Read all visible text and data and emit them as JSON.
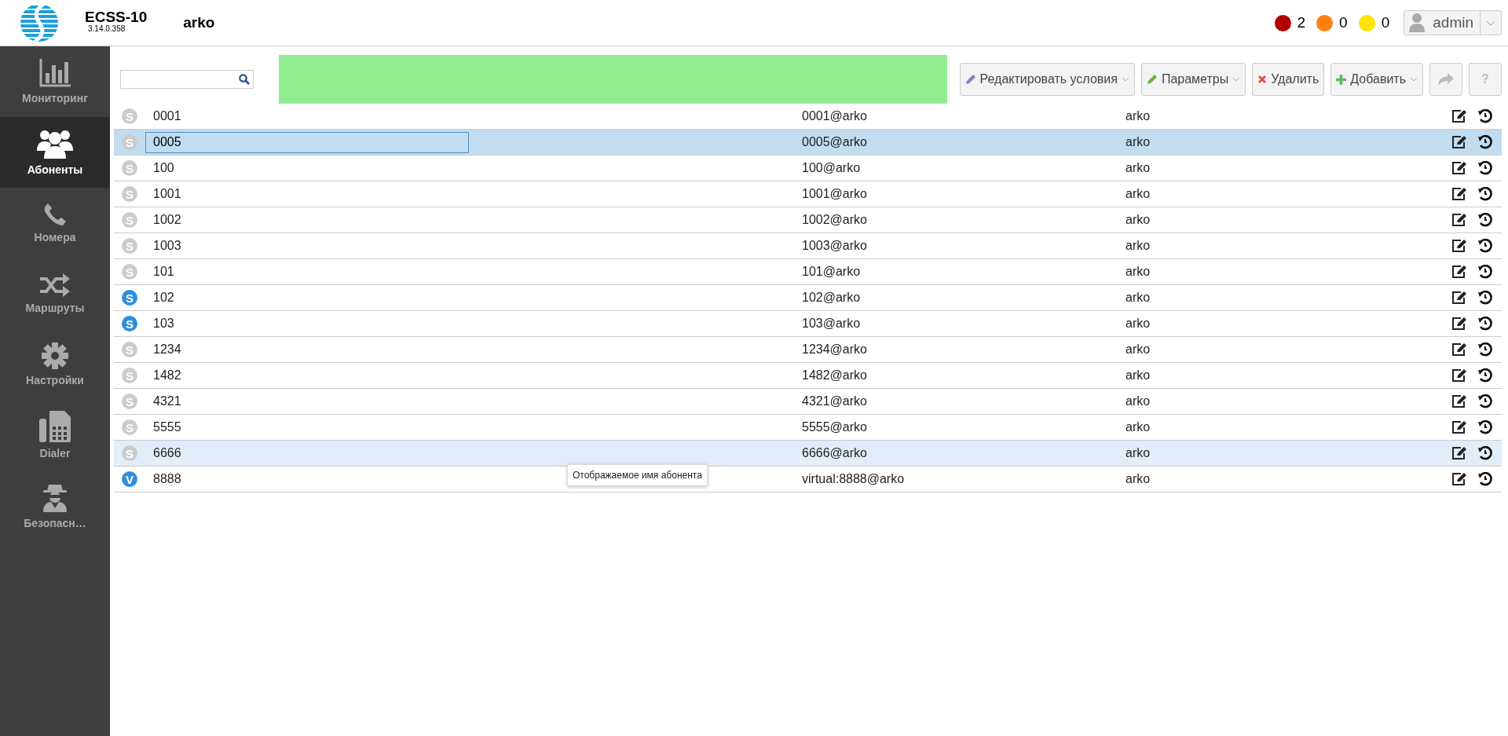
{
  "header": {
    "product": "ECSS-10",
    "version": "3.14.0.358",
    "domain": "arko",
    "alarms": [
      {
        "count": "2",
        "color": "#b30000"
      },
      {
        "count": "0",
        "color": "#ff7f0e"
      },
      {
        "count": "0",
        "color": "#ffe600"
      }
    ],
    "user": "admin"
  },
  "sidebar": {
    "items": [
      {
        "label": "Мониторинг",
        "kind": "chart",
        "selected": false
      },
      {
        "label": "Абоненты",
        "kind": "users",
        "selected": true
      },
      {
        "label": "Номера",
        "kind": "phone",
        "selected": false
      },
      {
        "label": "Маршруты",
        "kind": "shuffle",
        "selected": false
      },
      {
        "label": "Настройки",
        "kind": "gear",
        "selected": false
      },
      {
        "label": "Dialer",
        "kind": "fax",
        "selected": false
      },
      {
        "label": "Безопасн…",
        "kind": "spy",
        "selected": false
      }
    ]
  },
  "toolbar": {
    "buttons": [
      {
        "label": "Редактировать условия",
        "kind": "edit",
        "dropdown": true,
        "disabled": false
      },
      {
        "label": "Параметры",
        "kind": "params",
        "dropdown": true,
        "disabled": false
      },
      {
        "label": "Удалить",
        "kind": "delete",
        "dropdown": false,
        "disabled": false
      },
      {
        "label": "Добавить",
        "kind": "add",
        "dropdown": true,
        "disabled": false
      },
      {
        "kind": "share",
        "disabled": true
      },
      {
        "label": "?",
        "kind": "help",
        "disabled": true
      }
    ]
  },
  "table": {
    "rows": [
      {
        "badge": "S",
        "active": false,
        "number": "0001",
        "uri": "0001@arko",
        "domain": "arko",
        "selected": false,
        "editing": false,
        "hovered": false
      },
      {
        "badge": "S",
        "active": false,
        "number": "0005",
        "uri": "0005@arko",
        "domain": "arko",
        "selected": true,
        "editing": true,
        "hovered": false
      },
      {
        "badge": "S",
        "active": false,
        "number": "100",
        "uri": "100@arko",
        "domain": "arko",
        "selected": false,
        "editing": false,
        "hovered": false
      },
      {
        "badge": "S",
        "active": false,
        "number": "1001",
        "uri": "1001@arko",
        "domain": "arko",
        "selected": false,
        "editing": false,
        "hovered": false
      },
      {
        "badge": "S",
        "active": false,
        "number": "1002",
        "uri": "1002@arko",
        "domain": "arko",
        "selected": false,
        "editing": false,
        "hovered": false
      },
      {
        "badge": "S",
        "active": false,
        "number": "1003",
        "uri": "1003@arko",
        "domain": "arko",
        "selected": false,
        "editing": false,
        "hovered": false
      },
      {
        "badge": "S",
        "active": false,
        "number": "101",
        "uri": "101@arko",
        "domain": "arko",
        "selected": false,
        "editing": false,
        "hovered": false
      },
      {
        "badge": "S",
        "active": true,
        "number": "102",
        "uri": "102@arko",
        "domain": "arko",
        "selected": false,
        "editing": false,
        "hovered": false
      },
      {
        "badge": "S",
        "active": true,
        "number": "103",
        "uri": "103@arko",
        "domain": "arko",
        "selected": false,
        "editing": false,
        "hovered": false
      },
      {
        "badge": "S",
        "active": false,
        "number": "1234",
        "uri": "1234@arko",
        "domain": "arko",
        "selected": false,
        "editing": false,
        "hovered": false
      },
      {
        "badge": "S",
        "active": false,
        "number": "1482",
        "uri": "1482@arko",
        "domain": "arko",
        "selected": false,
        "editing": false,
        "hovered": false
      },
      {
        "badge": "S",
        "active": false,
        "number": "4321",
        "uri": "4321@arko",
        "domain": "arko",
        "selected": false,
        "editing": false,
        "hovered": false
      },
      {
        "badge": "S",
        "active": false,
        "number": "5555",
        "uri": "5555@arko",
        "domain": "arko",
        "selected": false,
        "editing": false,
        "hovered": false
      },
      {
        "badge": "S",
        "active": false,
        "number": "6666",
        "uri": "6666@arko",
        "domain": "arko",
        "selected": false,
        "editing": false,
        "hovered": true
      },
      {
        "badge": "V",
        "active": true,
        "number": "8888",
        "uri": "virtual:8888@arko",
        "domain": "arko",
        "selected": false,
        "editing": false,
        "hovered": false
      }
    ]
  },
  "tooltip": "Отображаемое имя абонента"
}
